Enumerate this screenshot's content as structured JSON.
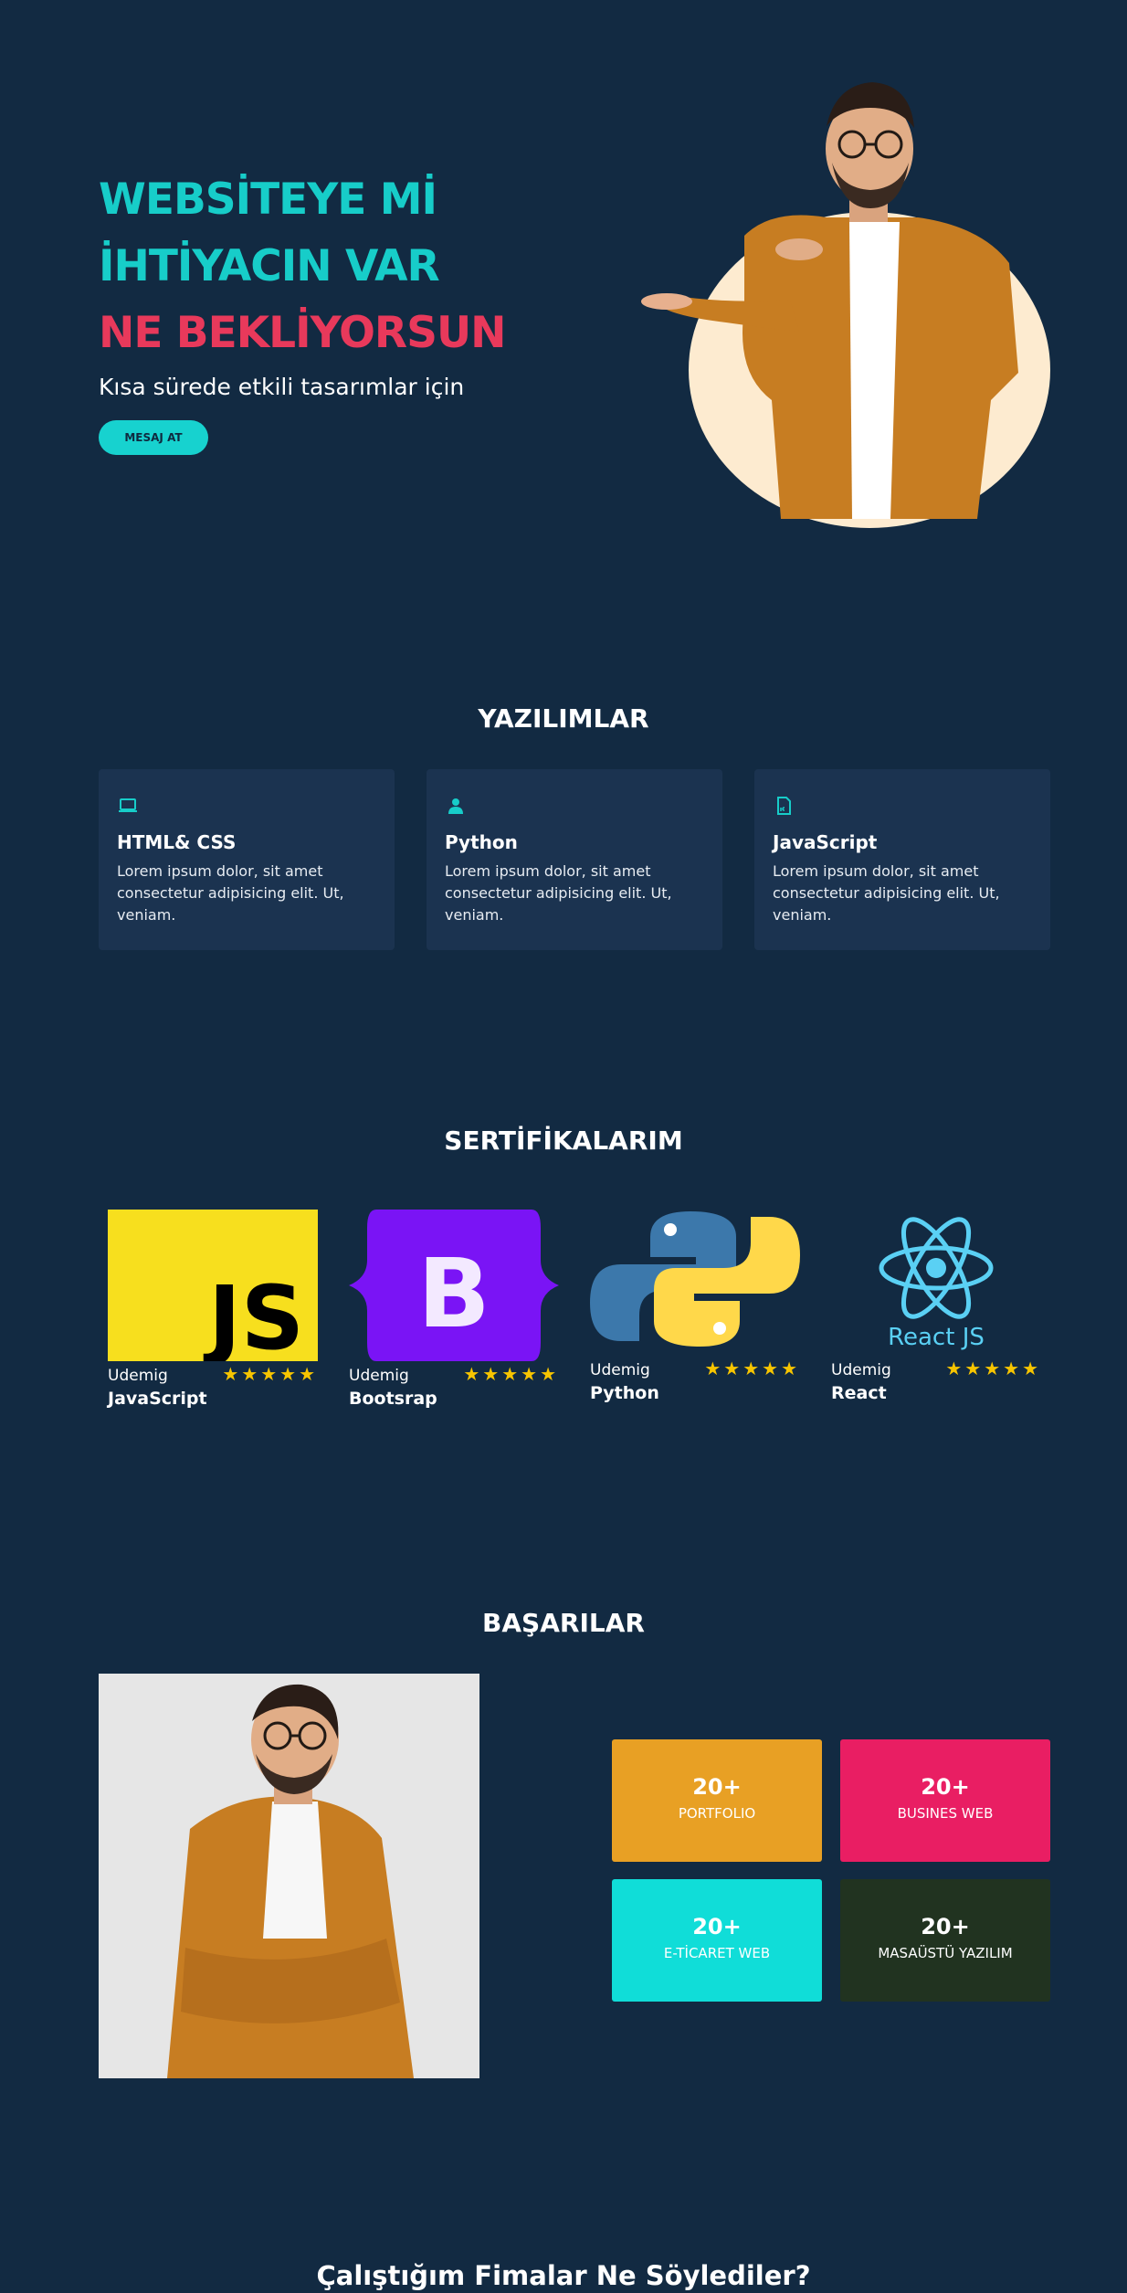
{
  "hero": {
    "line1": "WEBSİTEYE Mİ",
    "line2": "İHTİYACIN VAR",
    "line3": "NE BEKLİYORSUN",
    "subtitle": "Kısa sürede etkili tasarımlar için",
    "button": "MESAJ AT"
  },
  "software": {
    "title": "YAZILIMLAR",
    "cards": [
      {
        "icon": "laptop-icon",
        "title": "HTML& CSS",
        "text": "Lorem ipsum dolor, sit amet consectetur adipisicing elit. Ut, veniam."
      },
      {
        "icon": "user-icon",
        "title": "Python",
        "text": "Lorem ipsum dolor, sit amet consectetur adipisicing elit. Ut, veniam."
      },
      {
        "icon": "file-icon",
        "title": "JavaScript",
        "text": "Lorem ipsum dolor, sit amet consectetur adipisicing elit. Ut, veniam."
      }
    ]
  },
  "certificates": {
    "title": "SERTİFİKALARIM",
    "items": [
      {
        "source": "Udemig",
        "name": "JavaScript",
        "rating": 5,
        "logo_text": "JS"
      },
      {
        "source": "Udemig",
        "name": "Bootsrap",
        "rating": 5,
        "logo_text": "B"
      },
      {
        "source": "Udemig",
        "name": "Python",
        "rating": 5
      },
      {
        "source": "Udemig",
        "name": "React",
        "rating": 5,
        "logo_text": "React JS"
      }
    ]
  },
  "achievements": {
    "title": "BAŞARILAR",
    "stats": [
      {
        "value": "20+",
        "label": "PORTFOLIO",
        "color": "#e8a024"
      },
      {
        "value": "20+",
        "label": "BUSINES WEB",
        "color": "#e91e63"
      },
      {
        "value": "20+",
        "label": "E-TİCARET WEB",
        "color": "#10ddd8"
      },
      {
        "value": "20+",
        "label": "MASAÜSTÜ YAZILIM",
        "color": "#213320"
      }
    ]
  },
  "testimonials": {
    "title": "Çalıştığım Fimalar Ne Söylediler?"
  },
  "colors": {
    "background": "#122a42",
    "teal": "#17cdc9",
    "pink": "#e8395b",
    "card": "#1b3350",
    "star": "#f7c500"
  }
}
